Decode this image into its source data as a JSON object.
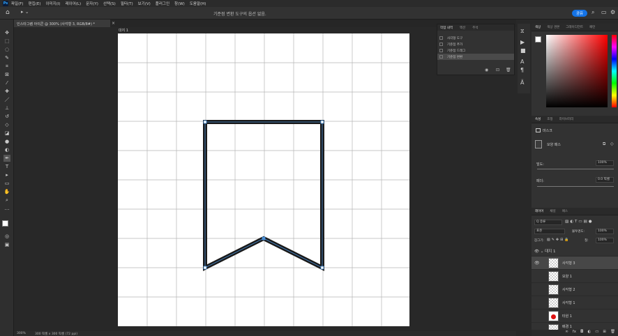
{
  "menu": {
    "logo": "Ps",
    "items": [
      "파일(F)",
      "편집(E)",
      "이미지(I)",
      "레이어(L)",
      "문자(Y)",
      "선택(S)",
      "필터(T)",
      "보기(V)",
      "플러그인",
      "창(W)",
      "도움말(H)"
    ]
  },
  "options": {
    "hint": "기준점 변환 도구의 옵션 없음.",
    "share": "공유"
  },
  "document": {
    "tab": "인스타그램 아이콘 @ 300% (사각형 3, RGB/8#) *",
    "artboard": "대지 1"
  },
  "status": {
    "zoom": "300%",
    "size": "300 픽셀 x 300 픽셀 (72 ppi)"
  },
  "history": {
    "tabs": [
      "작업 내역",
      "액션",
      "주석"
    ],
    "items": [
      "사각형 도구",
      "기준점 추가",
      "기준점 드래그",
      "기준점 변환"
    ],
    "selected_index": 3
  },
  "color_panel": {
    "tabs": [
      "색상",
      "색상 견본",
      "그레이디언트",
      "패턴"
    ]
  },
  "properties": {
    "tabs": [
      "속성",
      "조정",
      "라이브러리"
    ],
    "mask_label": "마스크",
    "vector_mask_label": "모양 패스",
    "density_label": "밀도:",
    "density_value": "100%",
    "feather_label": "페더:",
    "feather_value": "0.0 픽셀"
  },
  "layers": {
    "tabs": [
      "레이어",
      "채널",
      "패스"
    ],
    "filter_kind": "Q 종류",
    "blend_mode": "표준",
    "opacity_label": "불투명도:",
    "opacity_value": "100%",
    "lock_label": "잠그기:",
    "fill_label": "칠:",
    "fill_value": "100%",
    "group": "대지 1",
    "items": [
      {
        "name": "사각형 3",
        "selected": true,
        "visible": true
      },
      {
        "name": "모양 1",
        "selected": false,
        "visible": false
      },
      {
        "name": "사각형 2",
        "selected": false,
        "visible": false
      },
      {
        "name": "사각형 1",
        "selected": false,
        "visible": false
      },
      {
        "name": "타원 1",
        "selected": false,
        "visible": false
      },
      {
        "name": "배경 1",
        "selected": false,
        "visible": false
      }
    ]
  },
  "colors": {
    "accent": "#1473e6",
    "anchor": "#4a8fd6"
  }
}
